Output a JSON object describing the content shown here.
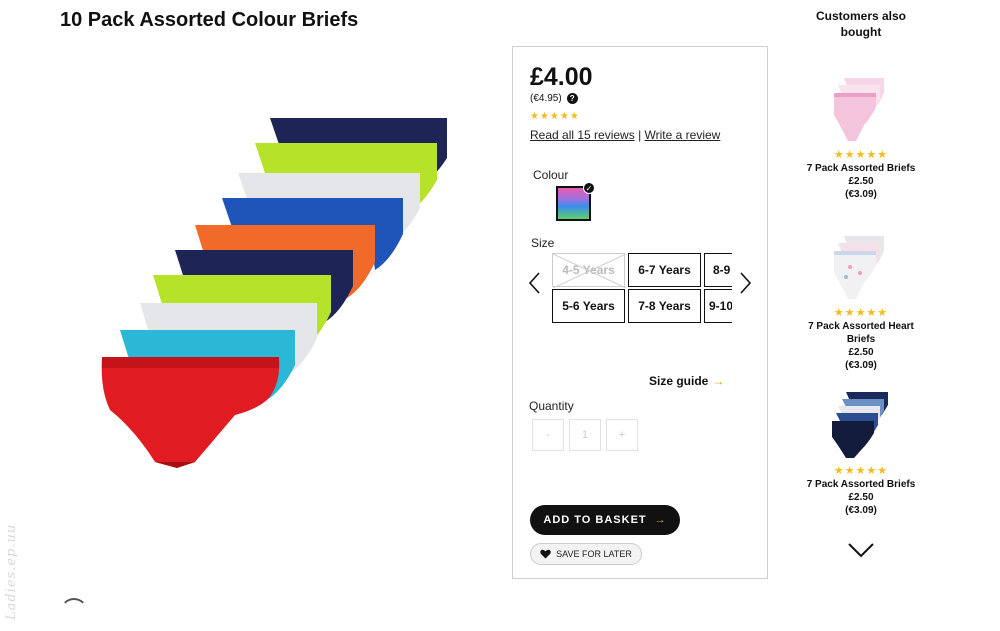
{
  "product": {
    "title": "10 Pack Assorted Colour Briefs"
  },
  "buy_box": {
    "price": "£4.00",
    "euro_price": "(€4.95)",
    "rating_stars": "★★★★★",
    "read_reviews": "Read all 15 reviews",
    "separator": "|",
    "write_review": "Write a review",
    "colour_label": "Colour",
    "size_label": "Size",
    "sizes": [
      {
        "label": "4-5 Years",
        "available": false
      },
      {
        "label": "6-7 Years",
        "available": true
      },
      {
        "label": "8-9",
        "available": true
      },
      {
        "label": "5-6 Years",
        "available": true
      },
      {
        "label": "7-8 Years",
        "available": true
      },
      {
        "label": "9-10",
        "available": true
      }
    ],
    "size_guide": "Size guide",
    "size_guide_arrow": "→",
    "quantity_label": "Quantity",
    "qty_minus": "-",
    "qty_value": "1",
    "qty_plus": "+",
    "add_to_basket": "ADD TO BASKET",
    "add_arrow": "→",
    "save_for_later": "SAVE FOR LATER",
    "help_icon": "?"
  },
  "rail": {
    "title": "Customers also bought",
    "items": [
      {
        "stars": "★★★★★",
        "name": "7 Pack Assorted Briefs",
        "price": "£2.50",
        "euro": "(€3.09)"
      },
      {
        "stars": "★★★★★",
        "name": "7 Pack Assorted Heart Briefs",
        "price": "£2.50",
        "euro": "(€3.09)"
      },
      {
        "stars": "★★★★★",
        "name": "7 Pack Assorted Briefs",
        "price": "£2.50",
        "euro": "(€3.09)"
      }
    ]
  },
  "watermark": "Ladies.ep.uu",
  "colors": {
    "star": "#f3bb1c",
    "accent_arrow": "#e5a400",
    "button": "#111111"
  }
}
